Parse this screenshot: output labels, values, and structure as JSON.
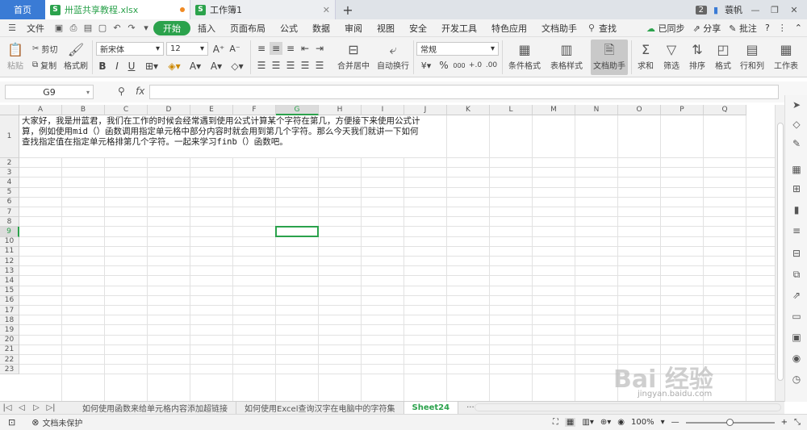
{
  "tabs": {
    "home": "首页",
    "doc1": "卅蓝共享教程.xlsx",
    "doc2": "工作簿1",
    "new": "+",
    "count": "2",
    "user": "蓑帆",
    "app_letter": "S"
  },
  "menu": {
    "file": "文件",
    "items": [
      "开始",
      "插入",
      "页面布局",
      "公式",
      "数据",
      "审阅",
      "视图",
      "安全",
      "开发工具",
      "特色应用",
      "文档助手"
    ],
    "search": "查找",
    "sync": "已同步",
    "share": "分享",
    "comment": "批注",
    "help": "?"
  },
  "ribbon": {
    "paste": "粘贴",
    "cut": "剪切",
    "copy": "复制",
    "format_painter": "格式刷",
    "font_name": "新宋体",
    "font_size": "12",
    "bold": "B",
    "italic": "I",
    "underline": "U",
    "merge": "合并居中",
    "wrap": "自动换行",
    "number_format": "常规",
    "percent": "%",
    "thousands": "000",
    "cond_format": "条件格式",
    "table_style": "表格样式",
    "doc_helper": "文档助手",
    "sum": "求和",
    "filter": "筛选",
    "sort": "排序",
    "format": "格式",
    "rows_cols": "行和列",
    "worksheet": "工作表"
  },
  "formula_bar": {
    "name_box": "G9",
    "fx": "fx",
    "content": ""
  },
  "grid": {
    "columns": [
      "A",
      "B",
      "C",
      "D",
      "E",
      "F",
      "G",
      "H",
      "I",
      "J",
      "K",
      "L",
      "M",
      "N",
      "O",
      "P",
      "Q"
    ],
    "rows": [
      "1",
      "2",
      "3",
      "4",
      "5",
      "6",
      "7",
      "8",
      "9",
      "10",
      "11",
      "12",
      "13",
      "14",
      "15",
      "16",
      "17",
      "18",
      "19",
      "20",
      "21",
      "22",
      "23"
    ],
    "selected_col": "G",
    "selected_row": "9",
    "a1_text": "大家好，我是卅蓝君，我们在工作的时候会经常遇到使用公式计算某个字符在第几，方便接下来使用公式计算，例如使用mid（）函数调用指定单元格中部分内容时就会用到第几个字符。那么今天我们就讲一下如何查找指定值在指定单元格排第几个字符。一起来学习finb（）函数吧。"
  },
  "sheets": {
    "tab1": "如何使用函数来给单元格内容添加超链接",
    "tab2": "如何使用Excel查询汉字在电脑中的字符集",
    "tab3": "Sheet24",
    "more": "···",
    "add": "+"
  },
  "status": {
    "protect": "文档未保护",
    "zoom": "100%"
  },
  "watermark": {
    "text": "Bai 经验",
    "url": "jingyan.baidu.com"
  }
}
